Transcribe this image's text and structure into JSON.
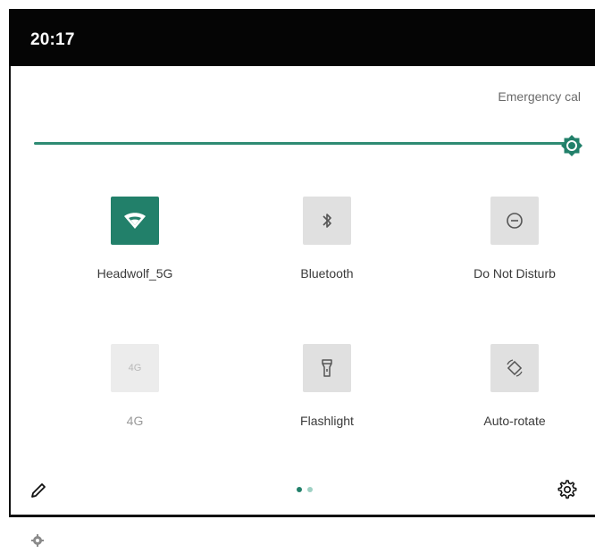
{
  "status_bar": {
    "time": "20:17"
  },
  "header": {
    "emergency_label": "Emergency cal"
  },
  "brightness": {
    "level": 1.0
  },
  "tiles": [
    {
      "label": "Headwolf_5G",
      "icon": "wifi-icon",
      "state": "on"
    },
    {
      "label": "Bluetooth",
      "icon": "bluetooth-icon",
      "state": "off"
    },
    {
      "label": "Do Not Disturb",
      "icon": "do-not-disturb-icon",
      "state": "off"
    },
    {
      "label": "4G",
      "icon_text": "4G",
      "icon": "mobile-data-icon",
      "state": "disabled"
    },
    {
      "label": "Flashlight",
      "icon": "flashlight-icon",
      "state": "off"
    },
    {
      "label": "Auto-rotate",
      "icon": "auto-rotate-icon",
      "state": "off"
    }
  ],
  "pager": {
    "current_page": 1,
    "total_pages": 2
  },
  "colors": {
    "accent": "#22806a",
    "tile_off": "#e0e0e0",
    "status_bar": "#050505"
  }
}
